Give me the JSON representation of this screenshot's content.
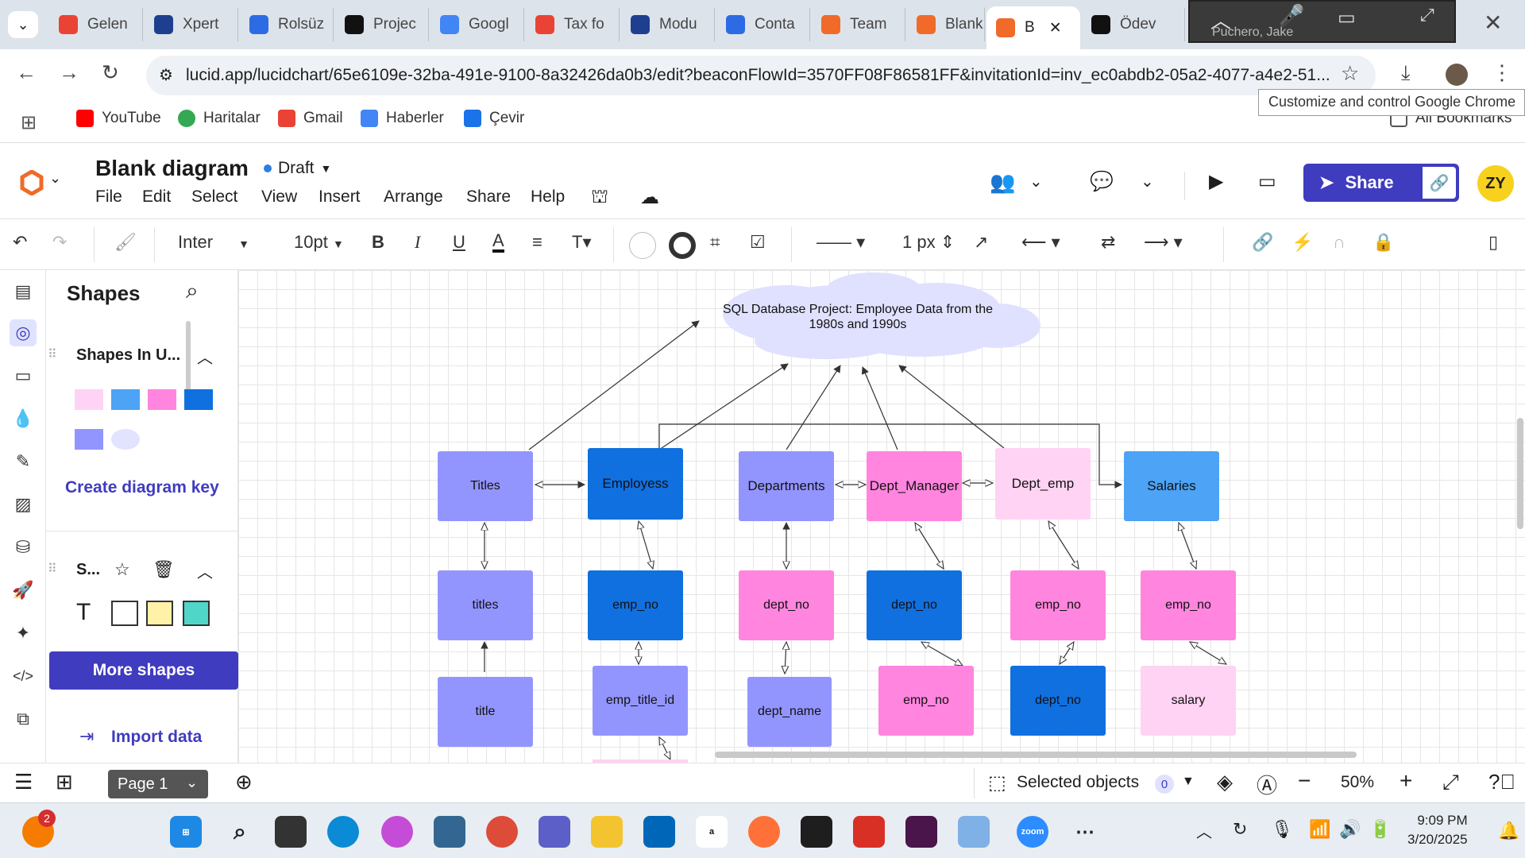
{
  "browser": {
    "tabs": [
      {
        "label": "Gelen",
        "icon": "gmail-icon",
        "color": "#ea4335"
      },
      {
        "label": "Xpert",
        "icon": "uci-icon",
        "color": "#1e3f8f"
      },
      {
        "label": "Rolsüz",
        "icon": "zm-icon",
        "color": "#2d6be4"
      },
      {
        "label": "Projec",
        "icon": "openai-icon",
        "color": "#111111"
      },
      {
        "label": "Googl",
        "icon": "google-translate-icon",
        "color": "#4285f4"
      },
      {
        "label": "Tax fo",
        "icon": "gmail-icon",
        "color": "#ea4335"
      },
      {
        "label": "Modu",
        "icon": "uci-icon",
        "color": "#1e3f8f"
      },
      {
        "label": "Conta",
        "icon": "2u-icon",
        "color": "#2d6be4"
      },
      {
        "label": "Team",
        "icon": "lucid-icon",
        "color": "#f06a2a"
      },
      {
        "label": "Blank",
        "icon": "lucid-icon",
        "color": "#f06a2a"
      },
      {
        "label": "B",
        "icon": "lucid-icon",
        "color": "#f06a2a"
      },
      {
        "label": "Ödev",
        "icon": "openai-icon",
        "color": "#111111"
      }
    ],
    "video_overlay_name": "Puchero, Jake",
    "url": "lucid.app/lucidchart/65e6109e-32ba-491e-9100-8a32426da0b3/edit?beaconFlowId=3570FF08F86581FF&invitationId=inv_ec0abdb2-05a2-4077-a4e2-51...",
    "tooltip": "Customize and control Google Chrome",
    "bookmarks": [
      "YouTube",
      "Haritalar",
      "Gmail",
      "Haberler",
      "Çevir"
    ],
    "all_bookmarks": "All Bookmarks"
  },
  "app": {
    "doc_title": "Blank diagram",
    "status": "Draft",
    "menu": [
      "File",
      "Edit",
      "Select",
      "View",
      "Insert",
      "Arrange",
      "Share",
      "Help"
    ],
    "share_label": "Share",
    "avatar_initials": "ZY",
    "accent": "#3f3cbf"
  },
  "format_toolbar": {
    "font": "Inter",
    "font_size": "10pt",
    "line_width": "1 px"
  },
  "shapes_panel": {
    "title": "Shapes",
    "section1": "Shapes In U...",
    "create_key": "Create diagram key",
    "section2": "S...",
    "more_shapes": "More shapes",
    "import_data": "Import data",
    "swatch_colors": [
      "#ffd3f3",
      "#4da3f5",
      "#ff85df",
      "#1070e0",
      "#9395ff",
      "#e1e3ff"
    ]
  },
  "diagram": {
    "cloud_text": "SQL Database Project: Employee Data from the 1980s and 1990s",
    "nodes": {
      "titles_table": "Titles",
      "employees_table": "Employess",
      "departments_table": "Departments",
      "dept_manager_table": "Dept_Manager",
      "dept_emp_table": "Dept_emp",
      "salaries_table": "Salaries",
      "titles_col": "titles",
      "emp_no_col_1": "emp_no",
      "dept_no_col_1": "dept_no",
      "dept_no_col_2": "dept_no",
      "emp_no_col_2": "emp_no",
      "emp_no_col_3": "emp_no",
      "title_col": "title",
      "emp_title_id_col": "emp_title_id",
      "dept_name_col": "dept_name",
      "emp_no_col_4": "emp_no",
      "dept_no_col_3": "dept_no",
      "salary_col": "salary"
    }
  },
  "statusbar": {
    "page_label": "Page 1",
    "selected_objects": "Selected objects",
    "selected_count": "0",
    "zoom": "50%"
  },
  "taskbar": {
    "notification_count": "2",
    "time": "9:09 PM",
    "date": "3/20/2025"
  }
}
